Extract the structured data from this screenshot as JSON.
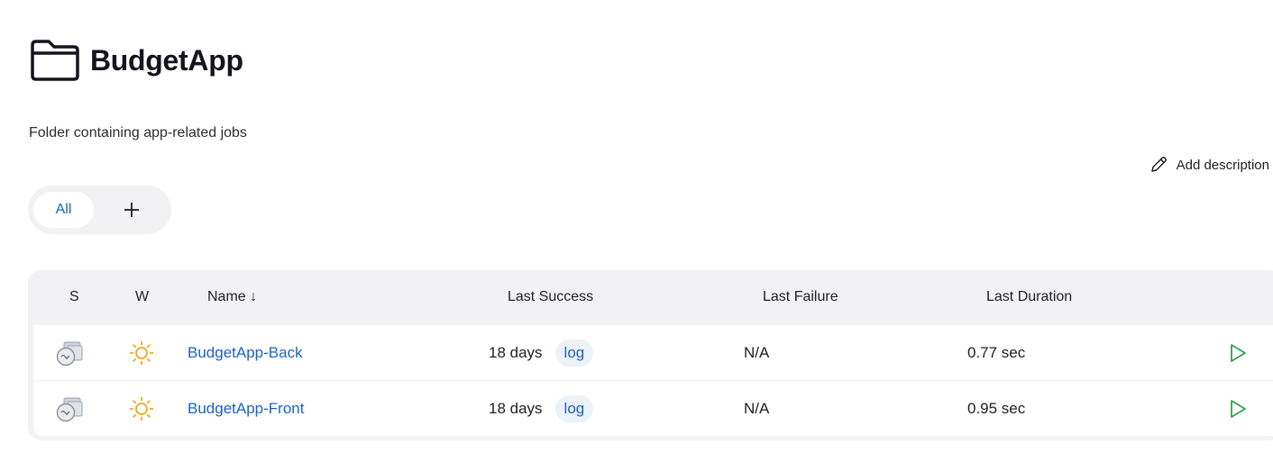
{
  "page": {
    "title": "BudgetApp",
    "description": "Folder containing app-related jobs",
    "add_description_label": "Add description"
  },
  "tabs": {
    "items": [
      {
        "label": "All",
        "active": true
      }
    ],
    "add_icon": "plus-icon"
  },
  "table": {
    "columns": {
      "status": "S",
      "weather": "W",
      "name": "Name ↓",
      "last_success": "Last Success",
      "last_failure": "Last Failure",
      "last_duration": "Last Duration"
    },
    "rows": [
      {
        "status_icon": "folder-job-icon",
        "weather_icon": "sun-icon",
        "name": "BudgetApp-Back",
        "last_success": "18 days",
        "log_label": "log",
        "last_failure": "N/A",
        "last_duration": "0.77 sec",
        "action_icon": "play-icon"
      },
      {
        "status_icon": "folder-job-icon",
        "weather_icon": "sun-icon",
        "name": "BudgetApp-Front",
        "last_success": "18 days",
        "log_label": "log",
        "last_failure": "N/A",
        "last_duration": "0.95 sec",
        "action_icon": "play-icon"
      }
    ]
  },
  "colors": {
    "link": "#1a62c4",
    "sun": "#f5a623",
    "play": "#2ea44f",
    "panel": "#f2f2f5"
  }
}
